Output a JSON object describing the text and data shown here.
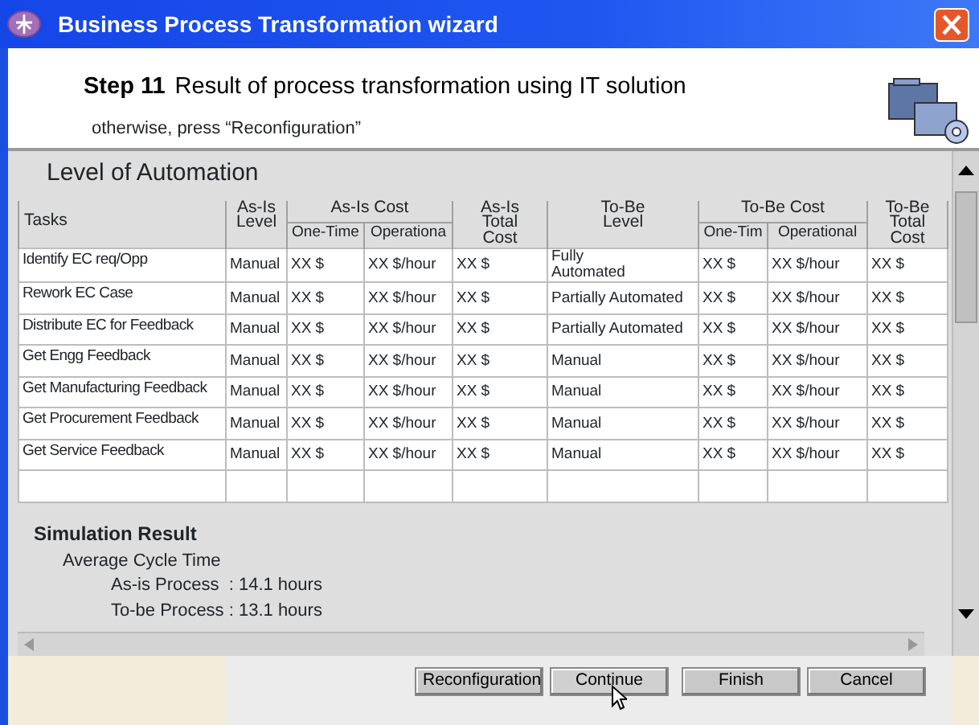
{
  "window": {
    "title": "Business Process Transformation wizard"
  },
  "step": {
    "number": "Step 11",
    "title": "Result of process transformation using IT solution",
    "hint": "otherwise, press “Reconfiguration”"
  },
  "section_title": "Level of Automation",
  "table": {
    "columns": [
      {
        "label": "Tasks"
      },
      {
        "label": "As-Is\nLevel"
      },
      {
        "label": "As-Is Cost",
        "colspan": 2,
        "subcolumns": [
          "One-Time",
          "Operationa"
        ]
      },
      {
        "label": "As-Is\nTotal\nCost"
      },
      {
        "label": "To-Be\nLevel"
      },
      {
        "label": "To-Be Cost",
        "colspan": 2,
        "subcolumns": [
          "One-Tim",
          "Operational"
        ]
      },
      {
        "label": "To-Be\nTotal\nCost"
      }
    ],
    "rows": [
      [
        "Identify EC req/Opp",
        "Manual",
        "XX $",
        "XX $/hour",
        "XX $",
        "Fully\nAutomated",
        "XX $",
        "XX $/hour",
        "XX $"
      ],
      [
        "Rework EC Case",
        "Manual",
        "XX $",
        "XX $/hour",
        "XX $",
        "Partially Automated",
        "XX $",
        "XX $/hour",
        "XX $"
      ],
      [
        "Distribute EC for Feedback",
        "Manual",
        "XX $",
        "XX $/hour",
        "XX $",
        "Partially Automated",
        "XX $",
        "XX $/hour",
        "XX $"
      ],
      [
        "Get Engg Feedback",
        "Manual",
        "XX $",
        "XX $/hour",
        "XX $",
        "Manual",
        "XX $",
        "XX $/hour",
        "XX $"
      ],
      [
        "Get Manufacturing Feedback",
        "Manual",
        "XX $",
        "XX $/hour",
        "XX $",
        "Manual",
        "XX $",
        "XX $/hour",
        "XX $"
      ],
      [
        "Get Procurement Feedback",
        "Manual",
        "XX $",
        "XX $/hour",
        "XX $",
        "Manual",
        "XX $",
        "XX $/hour",
        "XX $"
      ],
      [
        "Get Service Feedback",
        "Manual",
        "XX $",
        "XX $/hour",
        "XX $",
        "Manual",
        "XX $",
        "XX $/hour",
        "XX $"
      ]
    ]
  },
  "simulation": {
    "title": "Simulation Result",
    "subtitle": "Average Cycle Time",
    "lines": [
      "As-is Process  : 14.1 hours",
      "To-be Process : 13.1 hours"
    ]
  },
  "buttons": [
    {
      "label": "Reconfiguration",
      "hovered": false
    },
    {
      "label": "Continue",
      "hovered": true
    },
    {
      "label": "Finish",
      "hovered": false
    },
    {
      "label": "Cancel",
      "hovered": false
    }
  ]
}
